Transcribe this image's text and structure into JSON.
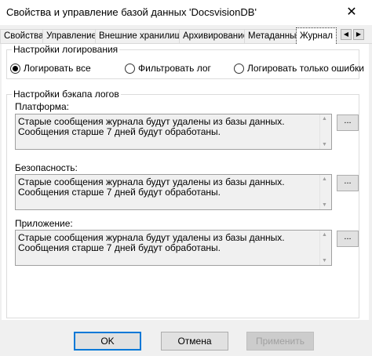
{
  "window": {
    "title": "Свойства и управление базой данных 'DocsvisionDB'",
    "close_glyph": "✕"
  },
  "tabs": [
    {
      "label": "Свойства"
    },
    {
      "label": "Управление"
    },
    {
      "label": "Внешние хранилища"
    },
    {
      "label": "Архивирование"
    },
    {
      "label": "Метаданные"
    },
    {
      "label": "Журнал"
    }
  ],
  "tab_scroll": {
    "left_glyph": "◀",
    "right_glyph": "▶"
  },
  "logging": {
    "legend": "Настройки логирования",
    "options": [
      {
        "label": "Логировать все",
        "selected": true
      },
      {
        "label": "Фильтровать лог",
        "selected": false
      },
      {
        "label": "Логировать только ошибки",
        "selected": false
      }
    ]
  },
  "backup": {
    "legend": "Настройки бэкапа логов",
    "sections": [
      {
        "label": "Платформа:",
        "text": "Старые сообщения журнала будут удалены из базы данных.\nСообщения старше 7 дней будут обработаны.",
        "browse": "..."
      },
      {
        "label": "Безопасность:",
        "text": "Старые сообщения журнала будут удалены из базы данных.\nСообщения старше 7 дней будут обработаны.",
        "browse": "..."
      },
      {
        "label": "Приложение:",
        "text": "Старые сообщения журнала будут удалены из базы данных.\nСообщения старше 7 дней будут обработаны.",
        "browse": "..."
      }
    ]
  },
  "buttons": {
    "ok": "OK",
    "cancel": "Отмена",
    "apply": "Применить"
  }
}
